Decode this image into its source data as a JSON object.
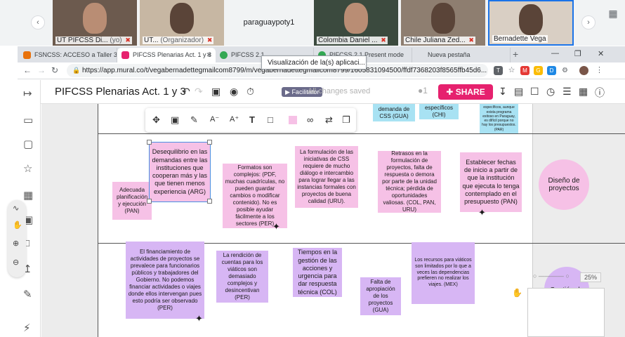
{
  "meeting": {
    "tiles": [
      {
        "name": "UT PIFCSS Di...",
        "sub": "(yo)"
      },
      {
        "name": "UT...",
        "sub": "(Organizador)"
      },
      {
        "name": "paraguaypoty1",
        "sub": ""
      },
      {
        "name": "Colombia Daniel ...",
        "sub": ""
      },
      {
        "name": "Chile Juliana Zed...",
        "sub": ""
      },
      {
        "name": "Bernadette Vega",
        "sub": ""
      }
    ],
    "prev_icon": "chevron-left-icon",
    "next_icon": "chevron-right-icon"
  },
  "browser": {
    "tabs": [
      {
        "label": "FSNCSS: ACCESO a Taller 3(",
        "fav_color": "#e8710a"
      },
      {
        "label": "PIFCSS Plenarias Act. 1 y 3",
        "fav_color": "#e6216e"
      },
      {
        "label": "PIFCSS 2.1",
        "fav_color": "#34a853"
      },
      {
        "label": "PIFCSS 2.1 Present mode",
        "fav_color": "#34a853"
      },
      {
        "label": "Nueva pestaña",
        "fav_color": "#dadce0"
      }
    ],
    "new_tab": "+",
    "url": "https://app.mural.co/t/vegabernadettegmailcom8799/m/vegabernadettegmailcom8799/1605831094500/ffdf7368203f8565ffb45d6...",
    "tooltip": "Visualización de la(s) aplicaci..."
  },
  "mural": {
    "title": "PIFCSS Plenarias Act. 1 y 3",
    "facilitator": "Facilitator",
    "saved_status": "All changes saved",
    "collaborators": "1",
    "share": "SHARE",
    "zoom": "25%"
  },
  "stickies": {
    "top_row": [
      {
        "text": "demanda de CSS (GUA)",
        "color": "cyan"
      },
      {
        "text": "específicos (CHI)",
        "color": "cyan"
      },
      {
        "text": "específicos, aunque exista programa exitoso en Paraguay, es difícil porque no hay los presupuestos. (PAR)",
        "color": "cyan"
      }
    ],
    "row1": [
      {
        "text": "Adecuada planificación y ejecución (PAN)",
        "color": "pink"
      },
      {
        "text": "Desequilibrio en las demandas entre las instituciones que cooperan más y las que tienen menos experiencia (ARG)",
        "color": "pink"
      },
      {
        "text": "Formatos son complejos: (PDF, muchas cuadrículas, no pueden guardar cambios o modificar contenido). No es posible ayudar fácilmente a los sectores (PER)",
        "color": "pink"
      },
      {
        "text": "La formulación de las iniciativas de CSS requiere de mucho diálogo e intercambio para lograr llegar a las instancias formales con proyectos de buena calidad (URU).",
        "color": "pink"
      },
      {
        "text": "Retrasos en la formulación de proyectos, falta de respuesta o demora por parte de la unidad técnica; pérdida de oportunidades valiosas. (COL, PAN, URU)",
        "color": "pink"
      },
      {
        "text": "Establecer fechas de inicio a partir de que la institución que ejecuta lo tenga contemplado en el presupuesto (PAN)",
        "color": "pink"
      }
    ],
    "row2": [
      {
        "text": "El financiamiento de actividades de proyectos se prevalece para funcionarios públicos y trabajadores del Gobierno. No podemos financiar actividades o viajes donde ellos intervengan pues esto podría ser observado (PER)",
        "color": "purple"
      },
      {
        "text": "La rendición de cuentas para los viáticos son demasiado complejos y desincentivan (PER)",
        "color": "purple"
      },
      {
        "text": "Tiempos en la gestión de las acciones y urgencia para dar respuesta técnica (COL)",
        "color": "purple"
      },
      {
        "text": "Falta de apropiación de los proyectos (GUA)",
        "color": "purple"
      },
      {
        "text": "Los recursos para viáticos son limitados por lo que a veces las dependencias prefieren no realizar los viajes. (MEX)",
        "color": "purple"
      }
    ],
    "circles": [
      {
        "text": "Diseño de proyectos",
        "color": "#f6c1e6"
      },
      {
        "text": "Gestión de proyectos",
        "color": "#d7b6f4"
      }
    ]
  },
  "toolbar_icons": [
    "move-icon",
    "focus-icon",
    "pen-icon",
    "font-decrease-icon",
    "font-increase-icon",
    "text-icon",
    "shape-icon",
    "color-icon",
    "link-icon",
    "swap-icon",
    "duplicate-icon"
  ]
}
